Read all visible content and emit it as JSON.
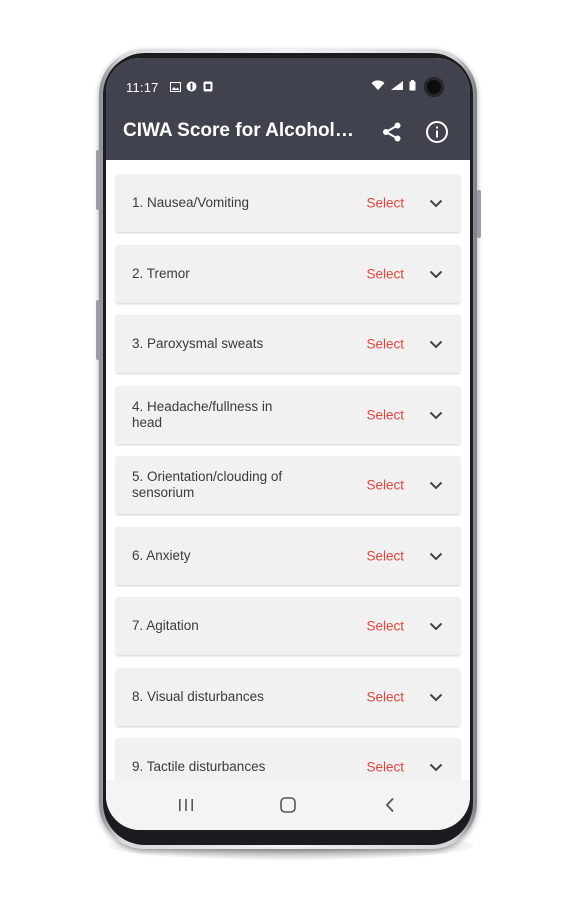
{
  "status_bar": {
    "time": "11:17",
    "left_icons": [
      "image-icon",
      "alarm-icon",
      "app-notification-icon"
    ],
    "right_icons": [
      "wifi-icon",
      "signal-icon",
      "battery-icon"
    ]
  },
  "app_bar": {
    "title": "CIWA Score for Alcohol Withdrawal",
    "actions": [
      "share-icon",
      "info-icon"
    ]
  },
  "criteria": [
    {
      "label": "1. Nausea/Vomiting",
      "value": "Select"
    },
    {
      "label": "2. Tremor",
      "value": "Select"
    },
    {
      "label": "3. Paroxysmal sweats",
      "value": "Select"
    },
    {
      "label": "4. Headache/fullness in head",
      "value": "Select"
    },
    {
      "label": "5. Orientation/clouding of sensorium",
      "value": "Select"
    },
    {
      "label": "6. Anxiety",
      "value": "Select"
    },
    {
      "label": "7. Agitation",
      "value": "Select"
    },
    {
      "label": "8. Visual disturbances",
      "value": "Select"
    },
    {
      "label": "9. Tactile disturbances",
      "value": "Select"
    }
  ],
  "nav_bar": {
    "buttons": [
      "recents-icon",
      "home-icon",
      "back-icon"
    ]
  },
  "colors": {
    "app_bar": "#40424e",
    "select_text": "#e2463e",
    "card_bg": "#f1f1f1"
  }
}
